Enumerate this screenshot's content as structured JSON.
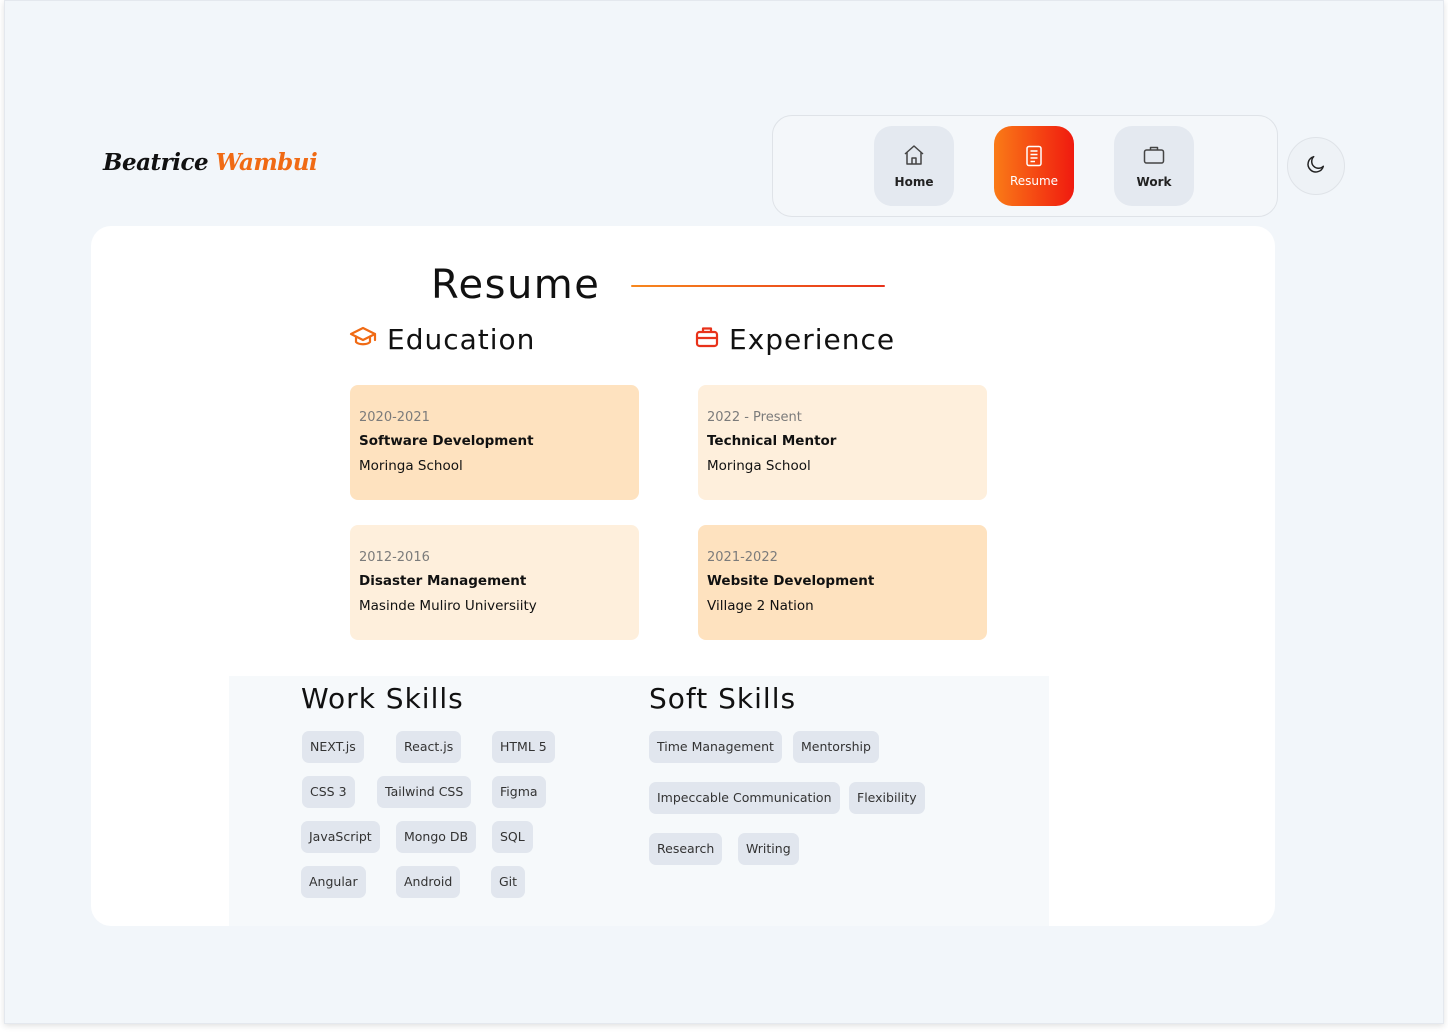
{
  "brand": {
    "first": "Beatrice",
    "last": "Wambui"
  },
  "nav": {
    "items": [
      {
        "label": "Home",
        "icon": "home-icon"
      },
      {
        "label": "Resume",
        "icon": "document-icon",
        "active": true
      },
      {
        "label": "Work",
        "icon": "briefcase-icon"
      }
    ]
  },
  "theme_toggle": {
    "icon": "moon-icon"
  },
  "resume": {
    "title": "Resume",
    "education": {
      "heading": "Education",
      "icon": "graduation-cap-icon",
      "entries": [
        {
          "period": "2020-2021",
          "role": "Software Development",
          "org": "Moringa School"
        },
        {
          "period": "2012-2016",
          "role": "Disaster Management",
          "org": "Masinde Muliro Universiity"
        }
      ]
    },
    "experience": {
      "heading": "Experience",
      "icon": "briefcase-icon",
      "entries": [
        {
          "period": "2022 - Present",
          "role": "Technical Mentor",
          "org": "Moringa School"
        },
        {
          "period": "2021-2022",
          "role": "Website Development",
          "org": "Village 2 Nation"
        }
      ]
    }
  },
  "work_skills": {
    "heading": "Work Skills",
    "items": [
      "NEXT.js",
      "React.js",
      "HTML 5",
      "CSS 3",
      "Tailwind CSS",
      "Figma",
      "JavaScript",
      "Mongo DB",
      "SQL",
      "Angular",
      "Android",
      "Git"
    ]
  },
  "soft_skills": {
    "heading": "Soft Skills",
    "items": [
      "Time Management",
      "Mentorship",
      "Impeccable Communication",
      "Flexibility",
      "Research",
      "Writing"
    ]
  },
  "colors": {
    "accent_start": "#fa7b17",
    "accent_end": "#f01a0f",
    "brand_last": "#f06a14",
    "card_dark": "#fee2bf",
    "card_light": "#feefdc"
  }
}
